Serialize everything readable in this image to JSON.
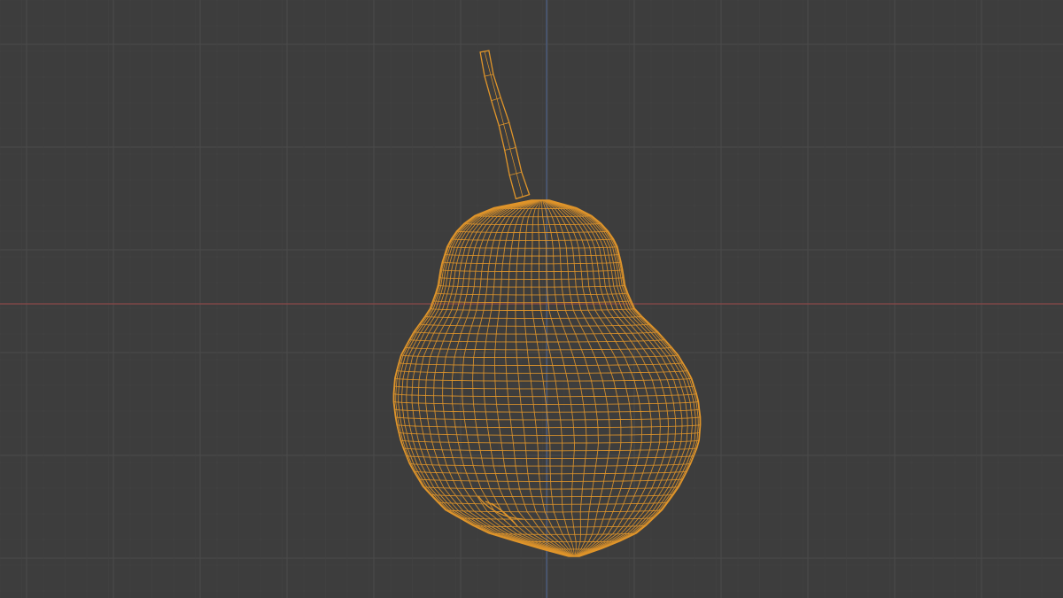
{
  "viewport": {
    "view_mode": "wireframe",
    "object": "pear-mesh",
    "colors": {
      "background": "#3d3d3d",
      "grid_minor": "#444444",
      "grid_major": "#4a4a4a",
      "axis_x": "#8a4848",
      "axis_z": "#4a5e86",
      "wire": "#e0952a"
    }
  }
}
